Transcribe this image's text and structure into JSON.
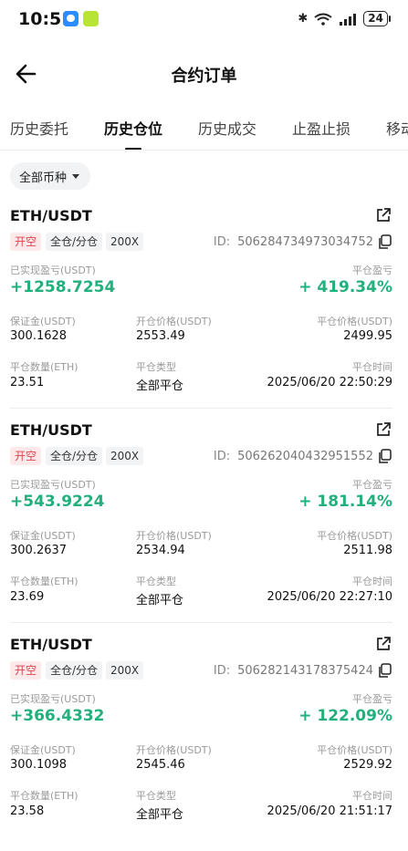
{
  "status": {
    "time": "10:51",
    "battery": "24"
  },
  "header": {
    "title": "合约订单"
  },
  "tabs": [
    "历史委托",
    "历史仓位",
    "历史成交",
    "止盈止损",
    "移动"
  ],
  "filter": {
    "label": "全部币种"
  },
  "labels": {
    "id": "ID:",
    "realized_pnl": "已实现盈亏(USDT)",
    "close_pnl_pct": "平仓盈亏",
    "margin": "保证金(USDT)",
    "open_price": "开仓价格(USDT)",
    "close_price": "平仓价格(USDT)",
    "close_qty": "平仓数量(ETH)",
    "close_type": "平仓类型",
    "close_time": "平仓时间"
  },
  "orders": [
    {
      "symbol": "ETH/USDT",
      "side": "开空",
      "mode": "全仓/分仓",
      "leverage": "200X",
      "id": "506284734973034752",
      "realized_pnl": "+1258.7254",
      "pnl_pct": "+ 419.34%",
      "margin": "300.1628",
      "open_price": "2553.49",
      "close_price": "2499.95",
      "qty": "23.51",
      "close_type": "全部平仓",
      "close_time": "2025/06/20 22:50:29"
    },
    {
      "symbol": "ETH/USDT",
      "side": "开空",
      "mode": "全仓/分仓",
      "leverage": "200X",
      "id": "506262040432951552",
      "realized_pnl": "+543.9224",
      "pnl_pct": "+ 181.14%",
      "margin": "300.2637",
      "open_price": "2534.94",
      "close_price": "2511.98",
      "qty": "23.69",
      "close_type": "全部平仓",
      "close_time": "2025/06/20 22:27:10"
    },
    {
      "symbol": "ETH/USDT",
      "side": "开空",
      "mode": "全仓/分仓",
      "leverage": "200X",
      "id": "506282143178375424",
      "realized_pnl": "+366.4332",
      "pnl_pct": "+ 122.09%",
      "margin": "300.1098",
      "open_price": "2545.46",
      "close_price": "2529.92",
      "qty": "23.58",
      "close_type": "全部平仓",
      "close_time": "2025/06/20 21:51:17"
    }
  ]
}
